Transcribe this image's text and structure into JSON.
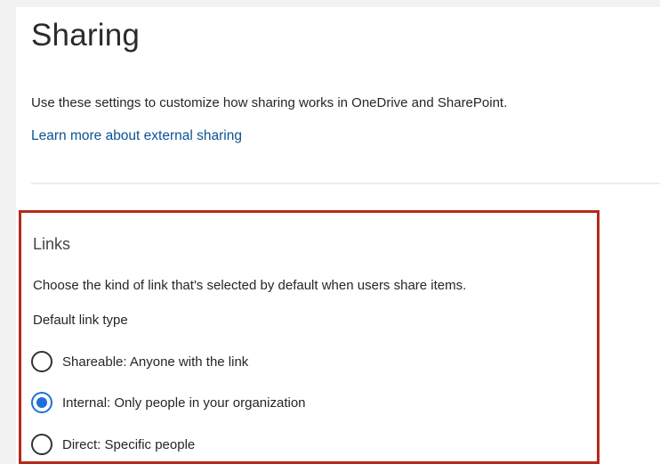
{
  "header": {
    "title": "Sharing",
    "description": "Use these settings to customize how sharing works in OneDrive and SharePoint.",
    "learn_more_link": "Learn more about external sharing"
  },
  "links_section": {
    "title": "Links",
    "description": "Choose the kind of link that's selected by default when users share items.",
    "default_link_type_label": "Default link type",
    "options": [
      {
        "label": "Shareable: Anyone with the link",
        "selected": false
      },
      {
        "label": "Internal: Only people in your organization",
        "selected": true
      },
      {
        "label": "Direct: Specific people",
        "selected": false
      }
    ],
    "highlight_color": "#b52a1c"
  },
  "colors": {
    "accent": "#1e6fd9",
    "link": "#0b5394"
  }
}
